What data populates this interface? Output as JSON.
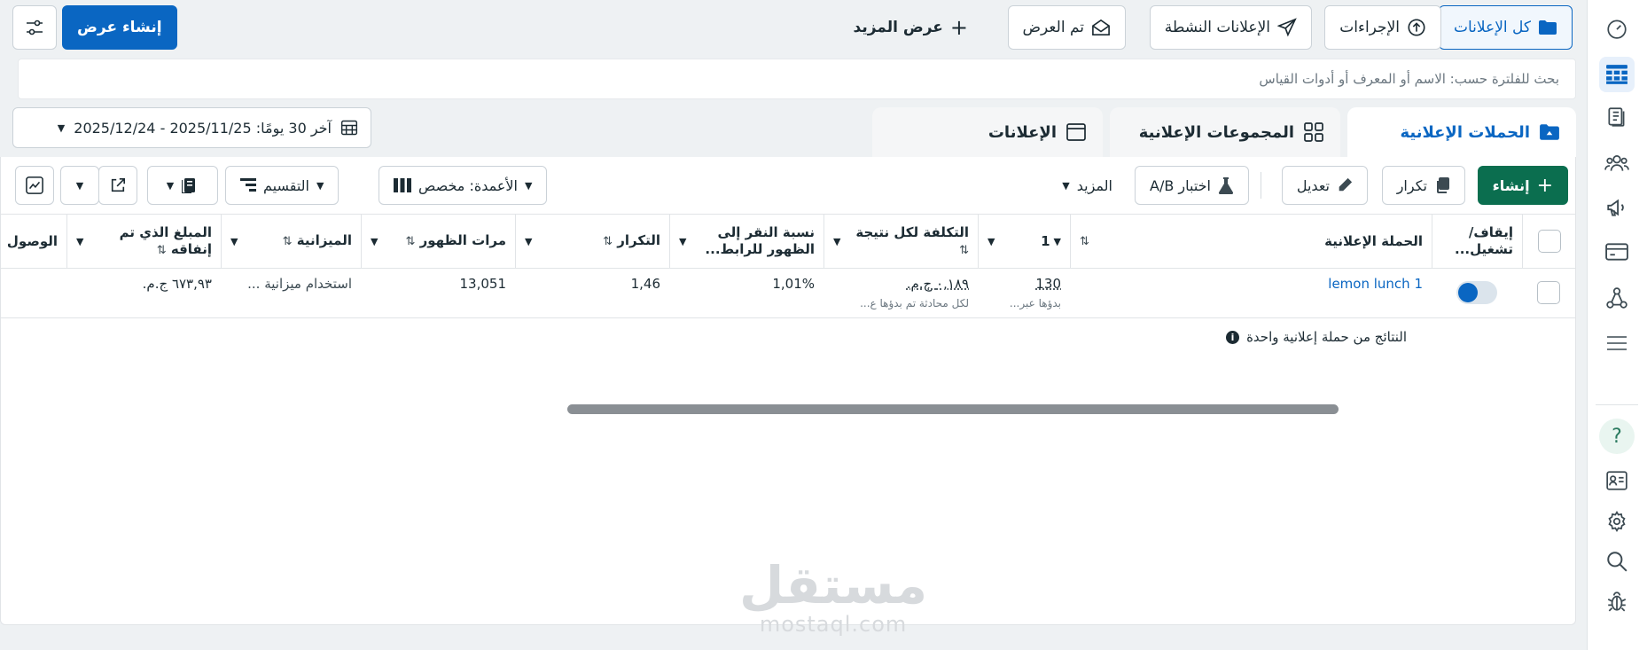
{
  "sidebar": {
    "icons": [
      "speedometer-icon",
      "table-grid-icon",
      "pages-icon",
      "people-icon",
      "megaphone-icon",
      "card-icon",
      "graph-nodes-icon",
      "menu-lines-icon",
      "help-icon",
      "id-card-icon",
      "gear-icon",
      "search-icon",
      "bug-icon"
    ],
    "help_glyph": "?"
  },
  "top_bar": {
    "all_ads": "كل الإعلانات",
    "actions": "الإجراءات",
    "active_ads": "الإعلانات النشطة",
    "shown": "تم العرض",
    "show_more": "عرض المزيد",
    "create_view": "إنشاء عرض"
  },
  "search": {
    "placeholder": "بحث للفلترة حسب: الاسم أو المعرف أو أدوات القياس"
  },
  "tabs": [
    {
      "label": "الحملات الإعلانية",
      "active": true
    },
    {
      "label": "المجموعات الإعلانية",
      "active": false
    },
    {
      "label": "الإعلانات",
      "active": false
    }
  ],
  "date_range": "آخر 30 يومًا: 2025/11/25 - 2025/12/24",
  "toolbar": {
    "create": "إنشاء",
    "duplicate": "تكرار",
    "edit": "تعديل",
    "ab_test": "اختبار A/B",
    "more": "المزيد",
    "columns": "الأعمدة: مخصص",
    "breakdown": "التقسيم"
  },
  "table": {
    "headers": {
      "toggle": [
        "إيقاف/",
        "تشغيل..."
      ],
      "campaign": "الحملة الإعلانية",
      "results": "1",
      "cost_per_result": "التكلفة لكل نتيجة",
      "ctr": [
        "نسبة النقر إلى",
        "الظهور للرابط..."
      ],
      "frequency": "التكرار",
      "impressions": "مرات الظهور",
      "budget": "الميزانية",
      "amount_spent": [
        "المبلغ الذي تم",
        "إنفاقه"
      ],
      "reach": "الوصول"
    },
    "row": {
      "campaign": "lemon lunch 1",
      "results": "130",
      "results_sub": "بدؤها عبر...",
      "cost_per_result": "٠,١٨٩ ج.م.",
      "cost_sub": "لكل محادثة تم بدؤها ع...",
      "ctr": "1,01%",
      "frequency": "1,46",
      "impressions": "13,051",
      "budget": "استخدام ميزانية ...",
      "amount_spent": "٦٧٣,٩٣ ج.م."
    },
    "results_note": "النتائج من حملة إعلانية واحدة",
    "info_glyph": "i"
  },
  "watermark": {
    "ar": "مستقل",
    "en": "mostaql.com"
  },
  "colors": {
    "primary": "#0a66c2",
    "green": "#0b6e4f",
    "text": "#1c2b33"
  }
}
